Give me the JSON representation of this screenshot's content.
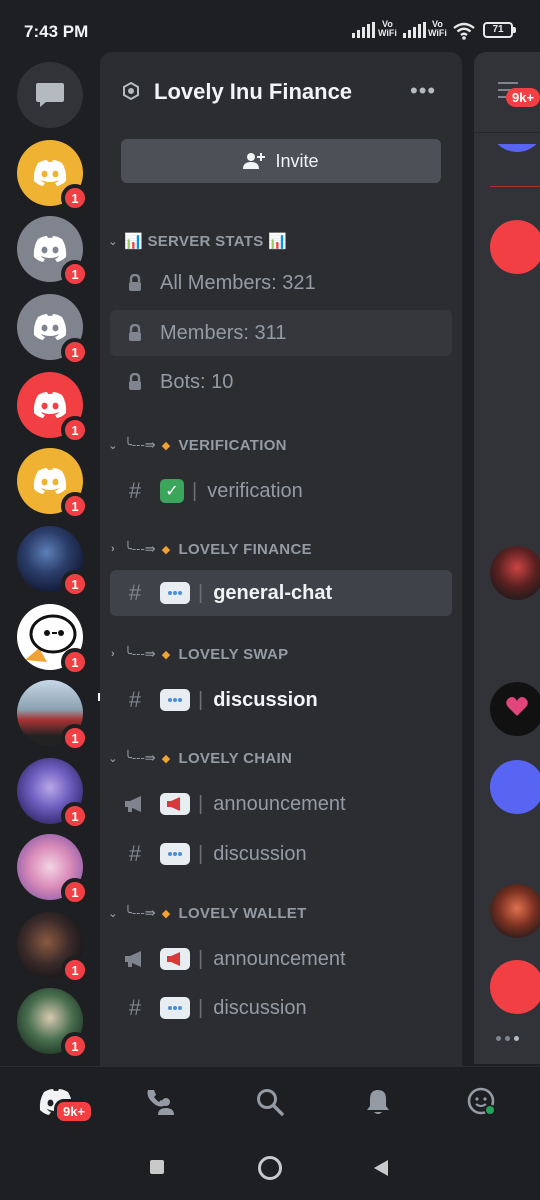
{
  "status_bar": {
    "time": "7:43 PM",
    "vo_label": "Vo",
    "wifi_label": "WiFi",
    "battery": "71"
  },
  "server": {
    "name": "Lovely Inu Finance",
    "more_label": "•••"
  },
  "invite_label": "Invite",
  "guild_badges": [
    "1",
    "1",
    "1",
    "1",
    "1",
    "1",
    "1",
    "1",
    "1",
    "1",
    "1",
    "1"
  ],
  "categories": {
    "server_stats": "📊 SERVER STATS 📊",
    "verification": "VERIFICATION",
    "lovely_finance": "LOVELY FINANCE",
    "lovely_swap": "LOVELY SWAP",
    "lovely_chain": "LOVELY CHAIN",
    "lovely_wallet": "LOVELY WALLET",
    "deco": "╰---⇛"
  },
  "channels": {
    "all_members": "All Members: 321",
    "members": "Members: 311",
    "bots": "Bots: 10",
    "verification": "verification",
    "general_chat": "general-chat",
    "swap_discussion": "discussion",
    "chain_announcement": "announcement",
    "chain_discussion": "discussion",
    "wallet_announcement": "announcement",
    "wallet_discussion": "discussion",
    "sep": "|"
  },
  "peek": {
    "mention_count": "9k+"
  },
  "bottom_nav": {
    "mention_count": "9k+"
  },
  "colors": {
    "accent": "#5865f2",
    "danger": "#f23f43",
    "panel": "#2b2d31",
    "rail": "#1e1f22"
  }
}
